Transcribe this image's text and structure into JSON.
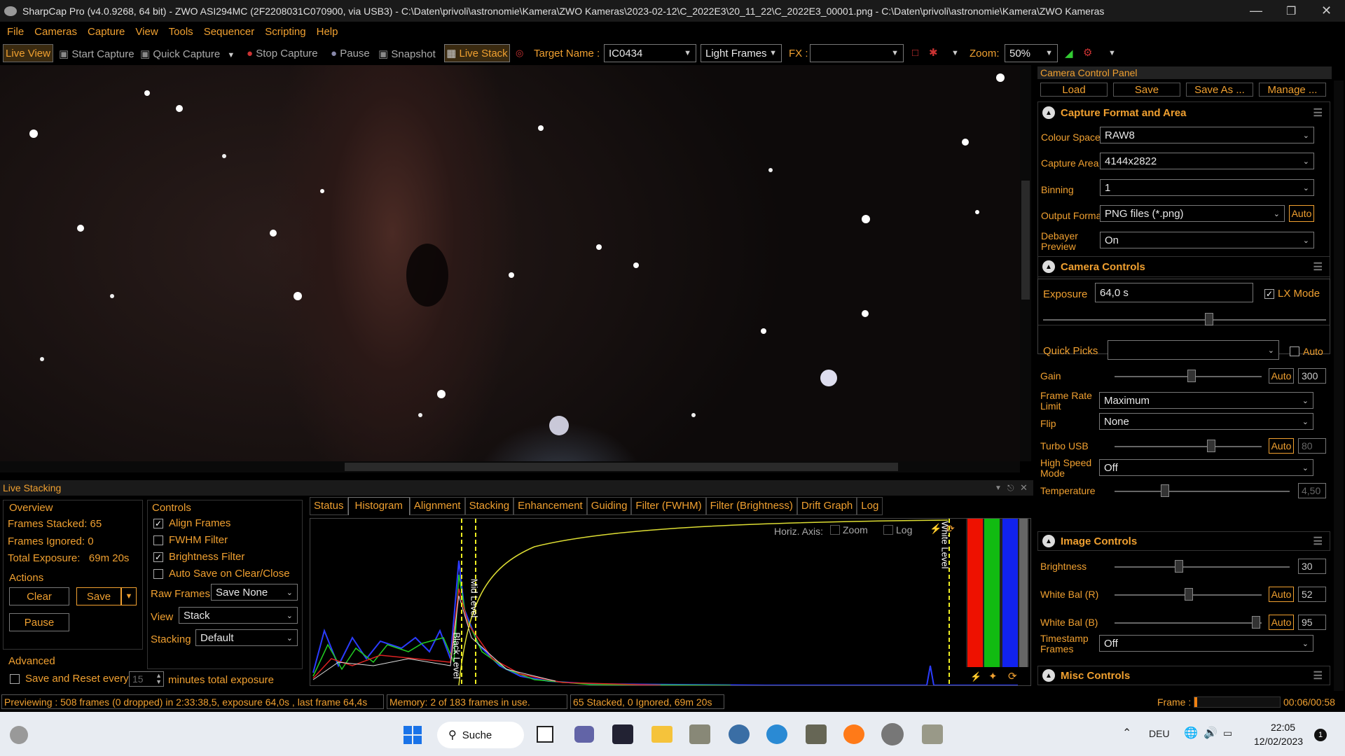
{
  "titlebar": {
    "title": "SharpCap Pro (v4.0.9268, 64 bit) - ZWO ASI294MC (2F2208031C070900, via USB3) - C:\\Daten\\privoli\\astronomie\\Kamera\\ZWO Kameras\\2023-02-12\\C_2022E3\\20_11_22\\C_2022E3_00001.png - C:\\Daten\\privoli\\astronomie\\Kamera\\ZWO Kameras"
  },
  "menu": [
    "File",
    "Cameras",
    "Capture",
    "View",
    "Tools",
    "Sequencer",
    "Scripting",
    "Help"
  ],
  "toolbar": {
    "live_view": "Live View",
    "start_capture": "Start Capture",
    "quick_capture": "Quick Capture",
    "stop_capture": "Stop Capture",
    "pause": "Pause",
    "snapshot": "Snapshot",
    "live_stack": "Live Stack",
    "target_label": "Target Name :",
    "target_value": "IC0434",
    "frame_type": "Light Frames",
    "fx_label": "FX :",
    "fx_value": "",
    "zoom_label": "Zoom:",
    "zoom_value": "50%"
  },
  "panel": {
    "title": "Camera Control Panel",
    "buttons": [
      "Load",
      "Save",
      "Save As ...",
      "Manage ..."
    ],
    "capture_format": {
      "title": "Capture Format and Area",
      "colour_space_label": "Colour Space",
      "colour_space": "RAW8",
      "capture_area_label": "Capture Area",
      "capture_area": "4144x2822",
      "binning_label": "Binning",
      "binning": "1",
      "output_format_label": "Output Format",
      "output_format": "PNG files (*.png)",
      "output_auto": "Auto",
      "debayer_label": "Debayer Preview",
      "debayer": "On"
    },
    "camera_controls": {
      "title": "Camera Controls",
      "exposure_label": "Exposure",
      "exposure": "64,0 s",
      "lx_mode": "LX Mode",
      "quick_picks_label": "Quick Picks",
      "quick_picks": "",
      "auto_label": "Auto",
      "gain_label": "Gain",
      "gain_auto": "Auto",
      "gain": "300",
      "frame_rate_label": "Frame Rate Limit",
      "frame_rate": "Maximum",
      "flip_label": "Flip",
      "flip": "None",
      "turbo_label": "Turbo USB",
      "turbo_auto": "Auto",
      "turbo": "80",
      "high_speed_label": "High Speed Mode",
      "high_speed": "Off",
      "temperature_label": "Temperature",
      "temperature": "4,50"
    },
    "image_controls": {
      "title": "Image Controls",
      "brightness_label": "Brightness",
      "brightness": "30",
      "wb_r_label": "White Bal (R)",
      "wb_r_auto": "Auto",
      "wb_r": "52",
      "wb_b_label": "White Bal (B)",
      "wb_b_auto": "Auto",
      "wb_b": "95",
      "timestamp_label": "Timestamp Frames",
      "timestamp": "Off"
    },
    "misc": {
      "title": "Misc Controls"
    }
  },
  "stacking": {
    "title": "Live Stacking",
    "overview_title": "Overview",
    "frames_stacked": "Frames Stacked: 65",
    "frames_ignored": "Frames Ignored: 0",
    "total_exposure": "Total Exposure:   69m 20s",
    "actions_title": "Actions",
    "clear": "Clear",
    "save": "Save",
    "pause": "Pause",
    "advanced_title": "Advanced",
    "save_reset": "Save and Reset every",
    "minutes": "15",
    "minutes_label": "minutes total exposure",
    "controls_title": "Controls",
    "align": "Align Frames",
    "fwhm": "FWHM Filter",
    "brightness": "Brightness Filter",
    "autosave": "Auto Save on Clear/Close",
    "raw_frames_label": "Raw Frames",
    "raw_frames": "Save None",
    "view_label": "View",
    "view": "Stack",
    "stacking_label": "Stacking",
    "stacking": "Default",
    "tabs": [
      "Status",
      "Histogram",
      "Alignment",
      "Stacking",
      "Enhancement",
      "Guiding",
      "Filter (FWHM)",
      "Filter (Brightness)",
      "Drift Graph",
      "Log"
    ],
    "horiz_axis": "Horiz. Axis:",
    "zoom": "Zoom",
    "log": "Log",
    "black_level": "Black Level",
    "mid_level": "Mid Level",
    "white_level": "White Level"
  },
  "status": {
    "preview": "Previewing : 508 frames (0 dropped) in 2:33:38,5, exposure 64,0s , last frame 64,4s",
    "memory": "Memory: 2 of 183 frames in use.",
    "stacked": "65 Stacked, 0 Ignored, 69m 20s",
    "frame_label": "Frame :",
    "frame_time": "00:06/00:58",
    "frame_progress": 0.03
  },
  "taskbar": {
    "search": "Suche",
    "lang": "DEU",
    "time": "22:05",
    "date": "12/02/2023",
    "notif": "1"
  }
}
